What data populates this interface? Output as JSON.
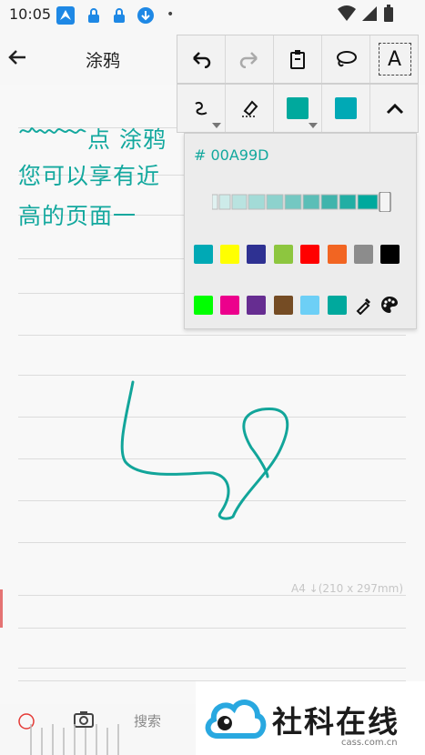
{
  "status_bar": {
    "time": "10:05",
    "left_icons": [
      "app-icon",
      "lock-icon",
      "lock-icon",
      "download-icon"
    ],
    "right_icons": [
      "wifi-icon",
      "signal-icon",
      "battery-icon"
    ]
  },
  "header": {
    "title": "涂鸦",
    "back_icon": "back-arrow-icon"
  },
  "note": {
    "line1_visible": "点 涂鸦",
    "line2_visible": "您可以享有近",
    "line3_visible": "高的页面一",
    "page_size_label": "A4 ↓(210 x 297mm)"
  },
  "toolbar": {
    "row1": [
      "undo-icon",
      "redo-icon",
      "clipboard-icon",
      "lasso-icon",
      "text-tool-icon"
    ],
    "text_tool_label": "A",
    "row2": [
      "pen-style-icon",
      "eraser-icon",
      "color-swatch",
      "color-swatch",
      "collapse-icon"
    ],
    "current_color": "#00A99D"
  },
  "color_panel": {
    "hex_label": "# 00A99D",
    "opacity_steps": 10,
    "palette_row1": [
      "#00A9B5",
      "#FFFF00",
      "#2E3192",
      "#8DC63F",
      "#FF0000",
      "#F26522",
      "#8C8C8C",
      "#000000"
    ],
    "palette_row2": [
      "#00FF00",
      "#EC008C",
      "#662D91",
      "#754C24",
      "#6DCFF6",
      "#00A99D"
    ],
    "extra_icons": [
      "eyedropper-icon",
      "palette-icon"
    ]
  },
  "bottom_bar": {
    "search_label": "搜索",
    "icons": [
      "record-icon",
      "camera-icon"
    ]
  },
  "watermark": {
    "brand_text": "社科在线",
    "url": "cass.com.cn"
  }
}
